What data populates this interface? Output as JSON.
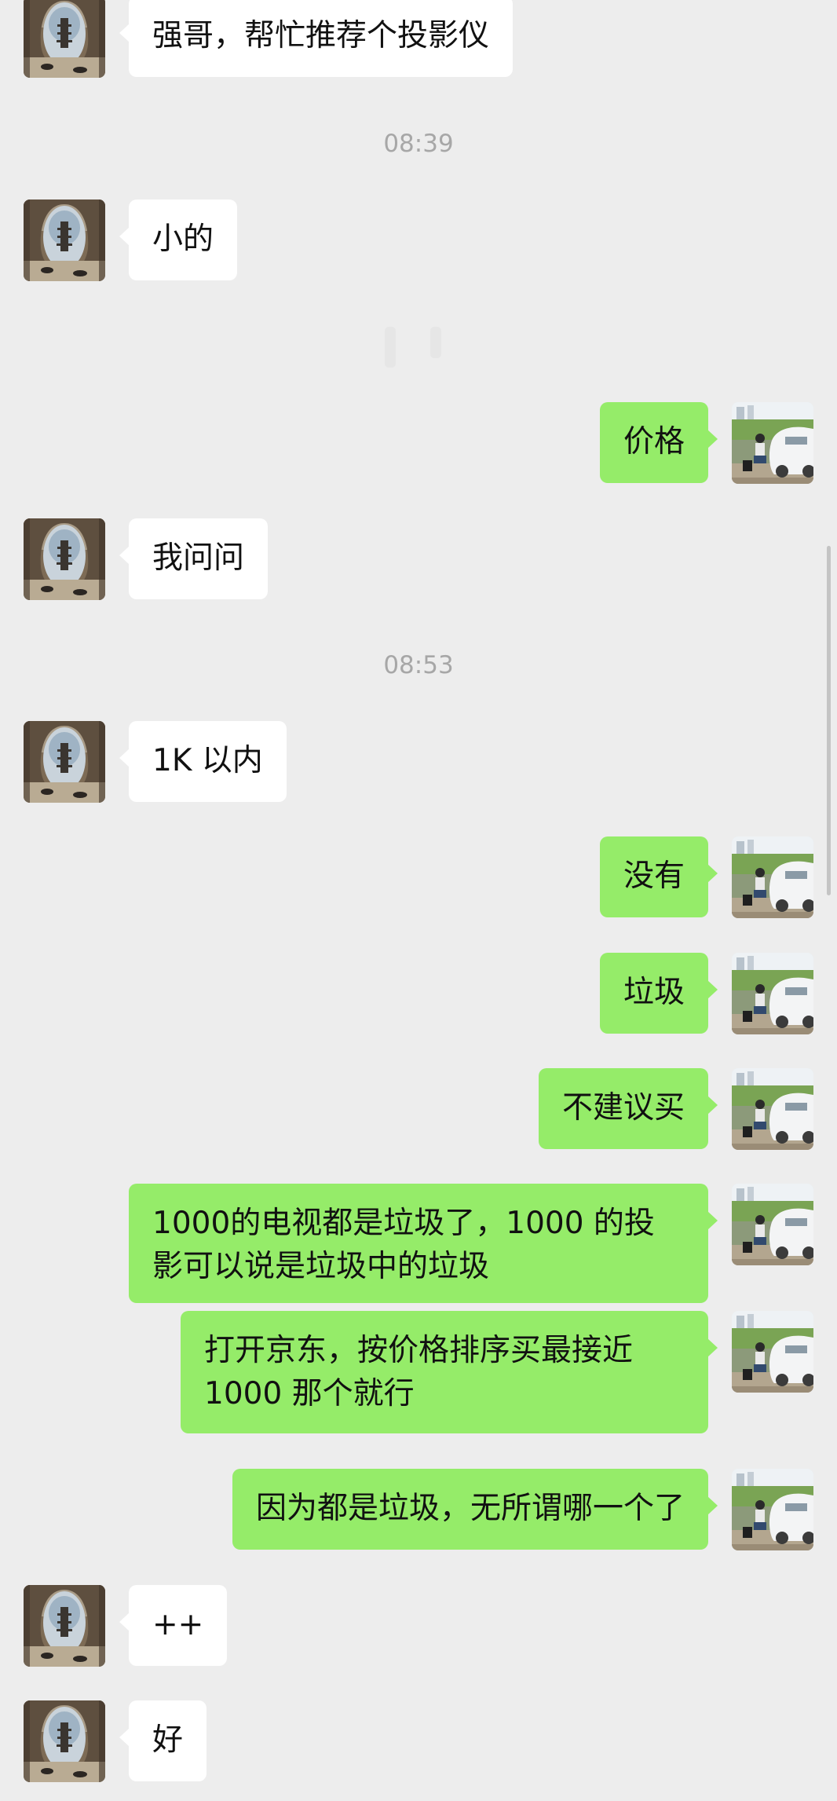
{
  "messages": [
    {
      "side": "left",
      "type": "text",
      "text": "强哥，帮忙推荐个投影仪"
    },
    {
      "type": "time",
      "text": "08:39"
    },
    {
      "side": "left",
      "type": "text",
      "text": "小的"
    },
    {
      "side": "right",
      "type": "text",
      "text": "价格"
    },
    {
      "side": "left",
      "type": "text",
      "text": "我问问"
    },
    {
      "type": "time",
      "text": "08:53"
    },
    {
      "side": "left",
      "type": "text",
      "text": "1K 以内"
    },
    {
      "side": "right",
      "type": "text",
      "text": "没有"
    },
    {
      "side": "right",
      "type": "text",
      "text": "垃圾"
    },
    {
      "side": "right",
      "type": "text",
      "text": "不建议买"
    },
    {
      "side": "right",
      "type": "text",
      "text": "1000的电视都是垃圾了，1000 的投影可以说是垃圾中的垃圾"
    },
    {
      "side": "right",
      "type": "text",
      "text": "打开京东，按价格排序买最接近 1000 那个就行"
    },
    {
      "side": "right",
      "type": "text",
      "text": "因为都是垃圾，无所谓哪一个了"
    },
    {
      "side": "left",
      "type": "text",
      "text": "++"
    },
    {
      "side": "left",
      "type": "text",
      "text": "好"
    }
  ],
  "colors": {
    "background": "#ededed",
    "incoming_bubble": "#ffffff",
    "outgoing_bubble": "#95ec69",
    "timestamp_text": "#a7a7a7"
  },
  "avatars": {
    "contact": "tower-through-arch-photo",
    "self": "man-beside-white-car-photo"
  }
}
